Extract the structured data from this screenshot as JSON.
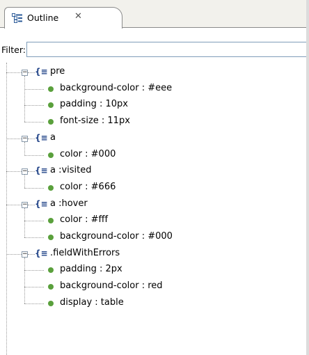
{
  "tab": {
    "label": "Outline",
    "close": "✕"
  },
  "filter": {
    "label": "Filter:",
    "value": "",
    "placeholder": ""
  },
  "rules": [
    {
      "selector": "pre",
      "properties": [
        "background-color : #eee",
        "padding : 10px",
        "font-size : 11px"
      ]
    },
    {
      "selector": "a",
      "properties": [
        "color : #000"
      ]
    },
    {
      "selector": "a :visited",
      "properties": [
        "color : #666"
      ]
    },
    {
      "selector": "a :hover",
      "properties": [
        "color : #fff",
        "background-color : #000"
      ]
    },
    {
      "selector": ".fieldWithErrors",
      "properties": [
        "padding : 2px",
        "background-color : red",
        "display : table"
      ]
    }
  ],
  "icons": {
    "rule": "css-rule-icon",
    "property": "css-property-icon",
    "expander": "collapse-icon"
  },
  "colors": {
    "property_icon": "#5aa03c",
    "rule_icon": "#224488"
  }
}
